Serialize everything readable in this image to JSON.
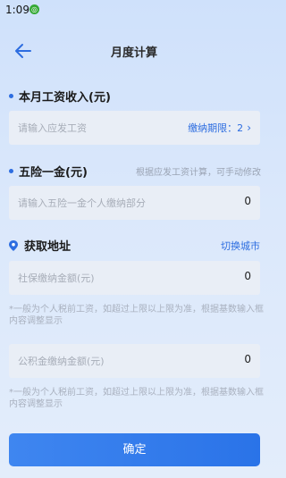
{
  "status_bar": {
    "time": "1:09",
    "notification_icon": "circle-app-icon"
  },
  "nav": {
    "title": "月度计算",
    "back_icon": "arrow-left-icon"
  },
  "salary": {
    "section_title": "本月工资收入(元)",
    "placeholder": "请输入应发工资",
    "limit_label": "缴纳期限：2",
    "limit_icon": "chevron-right-icon"
  },
  "insurance": {
    "section_title": "五险一金(元)",
    "hint": "根据应发工资计算，可手动修改",
    "placeholder": "请输入五险一金个人缴纳部分",
    "value": "0"
  },
  "location": {
    "section_title": "获取地址",
    "switch_city": "切换城市",
    "icon": "location-pin-icon"
  },
  "social_security": {
    "placeholder": "社保缴纳金额(元)",
    "value": "0",
    "note": "*一般为个人税前工资，如超过上限以上限为准，根据基数输入框内容调整显示"
  },
  "housing_fund": {
    "placeholder": "公积金缴纳金额(元)",
    "value": "0",
    "note": "*一般为个人税前工资，如超过上限以上限为准，根据基数输入框内容调整显示"
  },
  "confirm_label": "确定",
  "colors": {
    "accent": "#2d6de0",
    "background": "#d7e6fb",
    "field": "#e9eef6"
  }
}
